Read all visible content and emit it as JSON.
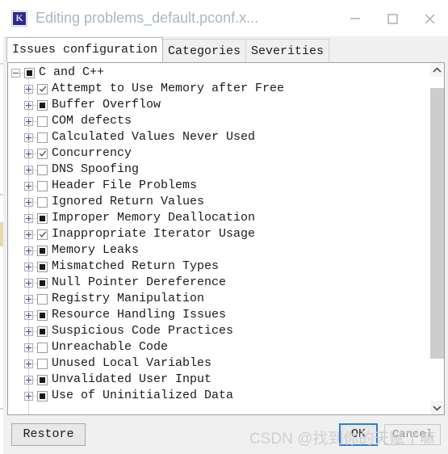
{
  "window": {
    "title": "Editing problems_default.pconf.x...",
    "icon": "app-k-icon",
    "controls": {
      "minimize": "minimize-icon",
      "maximize": "maximize-icon",
      "close": "close-icon"
    }
  },
  "tabs": [
    {
      "label": "Issues configuration",
      "selected": true
    },
    {
      "label": "Categories",
      "selected": false
    },
    {
      "label": "Severities",
      "selected": false
    }
  ],
  "tree": {
    "root": {
      "label": "C and C++",
      "state": "partial",
      "expanded": true,
      "expander": "minus-icon"
    },
    "items": [
      {
        "label": "Attempt to Use Memory after Free",
        "state": "checked",
        "expander": "plus-icon"
      },
      {
        "label": "Buffer Overflow",
        "state": "partial",
        "expander": "plus-icon"
      },
      {
        "label": "COM defects",
        "state": "unchecked",
        "expander": "plus-icon"
      },
      {
        "label": "Calculated Values Never Used",
        "state": "unchecked",
        "expander": "plus-icon"
      },
      {
        "label": "Concurrency",
        "state": "checked",
        "expander": "plus-icon"
      },
      {
        "label": "DNS Spoofing",
        "state": "unchecked",
        "expander": "plus-icon"
      },
      {
        "label": "Header File Problems",
        "state": "unchecked",
        "expander": "plus-icon"
      },
      {
        "label": "Ignored Return Values",
        "state": "unchecked",
        "expander": "plus-icon"
      },
      {
        "label": "Improper Memory Deallocation",
        "state": "partial",
        "expander": "plus-icon"
      },
      {
        "label": "Inappropriate Iterator Usage",
        "state": "checked",
        "expander": "plus-icon"
      },
      {
        "label": "Memory Leaks",
        "state": "partial",
        "expander": "plus-icon"
      },
      {
        "label": "Mismatched Return Types",
        "state": "partial",
        "expander": "plus-icon"
      },
      {
        "label": "Null Pointer Dereference",
        "state": "partial",
        "expander": "plus-icon"
      },
      {
        "label": "Registry Manipulation",
        "state": "unchecked",
        "expander": "plus-icon"
      },
      {
        "label": "Resource Handling Issues",
        "state": "partial",
        "expander": "plus-icon"
      },
      {
        "label": "Suspicious Code Practices",
        "state": "partial",
        "expander": "plus-icon"
      },
      {
        "label": "Unreachable Code",
        "state": "unchecked",
        "expander": "plus-icon"
      },
      {
        "label": "Unused Local Variables",
        "state": "unchecked",
        "expander": "plus-icon"
      },
      {
        "label": "Unvalidated User Input",
        "state": "partial",
        "expander": "plus-icon"
      },
      {
        "label": "Use of Uninitialized Data",
        "state": "partial",
        "expander": "plus-icon"
      }
    ]
  },
  "scrollbar": {
    "up_arrow": "chevron-up-icon",
    "down_arrow": "chevron-down-icon"
  },
  "buttons": {
    "restore": "Restore",
    "ok": "OK",
    "cancel": "Cancel"
  },
  "watermark": {
    "text": "CSDN @找到你的天赋了嘛"
  },
  "colors": {
    "focus_border": "#2a7fd4",
    "expander_glyph": "#3b4fa0",
    "title_text": "#a8b6c4",
    "scroll_thumb": "#cdcdcd"
  }
}
